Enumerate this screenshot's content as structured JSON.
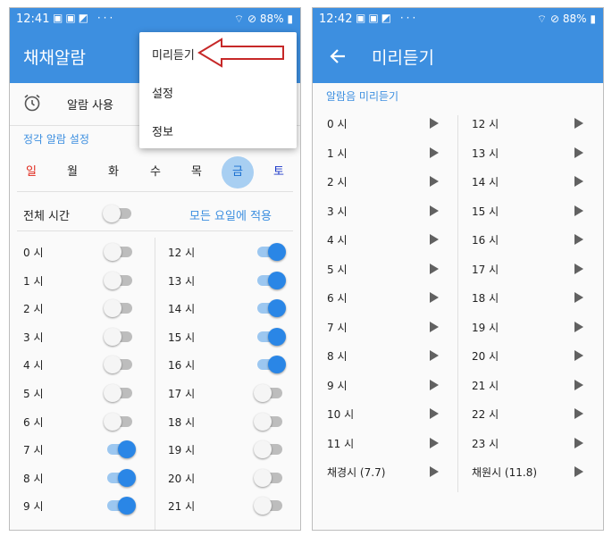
{
  "left": {
    "status": {
      "time": "12:41",
      "battery": "88%"
    },
    "app_title": "채채알람",
    "alarm_use_label": "알람 사용",
    "section_title": "정각 알람 설정",
    "days": [
      {
        "label": "일",
        "state": "sun"
      },
      {
        "label": "월",
        "state": ""
      },
      {
        "label": "화",
        "state": ""
      },
      {
        "label": "수",
        "state": ""
      },
      {
        "label": "목",
        "state": ""
      },
      {
        "label": "금",
        "state": "sel"
      },
      {
        "label": "토",
        "state": "sat"
      }
    ],
    "all_time_label": "전체 시간",
    "all_time_on": false,
    "apply_all_label": "모든 요일에 적용",
    "hours_left": [
      {
        "label": "0 시",
        "on": false
      },
      {
        "label": "1 시",
        "on": false
      },
      {
        "label": "2 시",
        "on": false
      },
      {
        "label": "3 시",
        "on": false
      },
      {
        "label": "4 시",
        "on": false
      },
      {
        "label": "5 시",
        "on": false
      },
      {
        "label": "6 시",
        "on": false
      },
      {
        "label": "7 시",
        "on": true
      },
      {
        "label": "8 시",
        "on": true
      },
      {
        "label": "9 시",
        "on": true
      }
    ],
    "hours_right": [
      {
        "label": "12 시",
        "on": true
      },
      {
        "label": "13 시",
        "on": true
      },
      {
        "label": "14 시",
        "on": true
      },
      {
        "label": "15 시",
        "on": true
      },
      {
        "label": "16 시",
        "on": true
      },
      {
        "label": "17 시",
        "on": false
      },
      {
        "label": "18 시",
        "on": false
      },
      {
        "label": "19 시",
        "on": false
      },
      {
        "label": "20 시",
        "on": false
      },
      {
        "label": "21 시",
        "on": false
      }
    ],
    "menu": {
      "items": [
        "미리듣기",
        "설정",
        "정보"
      ]
    }
  },
  "right": {
    "status": {
      "time": "12:42",
      "battery": "88%"
    },
    "app_title": "미리듣기",
    "section_title": "알람음 미리듣기",
    "col1": [
      "0 시",
      "1 시",
      "2 시",
      "3 시",
      "4 시",
      "5 시",
      "6 시",
      "7 시",
      "8 시",
      "9 시",
      "10 시",
      "11 시",
      "채경시 (7.7)"
    ],
    "col2": [
      "12 시",
      "13 시",
      "14 시",
      "15 시",
      "16 시",
      "17 시",
      "18 시",
      "19 시",
      "20 시",
      "21 시",
      "22 시",
      "23 시",
      "채원시 (11.8)"
    ]
  },
  "colors": {
    "accent": "#3d8fe0",
    "toggle_on": "#2a86e6",
    "sunday": "#e0281c",
    "saturday": "#1a37c8",
    "callout": "#c62828"
  }
}
